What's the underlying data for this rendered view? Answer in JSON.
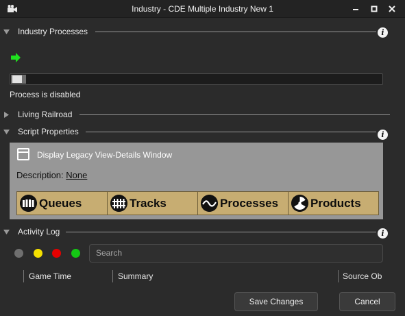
{
  "window": {
    "title": "Industry - CDE Multiple Industry New 1",
    "icon": "camera-icon",
    "controls": [
      "minimize-icon",
      "maximize-icon",
      "close-icon"
    ]
  },
  "sections": {
    "industry_processes": {
      "label": "Industry Processes",
      "expanded": true
    },
    "living_railroad": {
      "label": "Living Railroad",
      "expanded": false
    },
    "script_properties": {
      "label": "Script Properties",
      "expanded": true
    },
    "activity_log": {
      "label": "Activity Log",
      "expanded": true
    }
  },
  "process": {
    "status_text": "Process is disabled",
    "progress": 0.04,
    "arrow_color": "#1fe01f"
  },
  "script": {
    "legacy_label": "Display Legacy View-Details Window",
    "description_prefix": "Description:",
    "description_value": "None",
    "buttons": [
      {
        "label": "Queues",
        "icon": "queue-figures-icon"
      },
      {
        "label": "Tracks",
        "icon": "tracks-icon"
      },
      {
        "label": "Processes",
        "icon": "process-wave-icon"
      },
      {
        "label": "Products",
        "icon": "radiation-icon"
      }
    ],
    "panel_color": "#979797",
    "button_color": "#c7ad72"
  },
  "log": {
    "filters": [
      {
        "name": "grey",
        "color": "#6f6f6f"
      },
      {
        "name": "yellow",
        "color": "#f5e000"
      },
      {
        "name": "red",
        "color": "#e60000"
      },
      {
        "name": "green",
        "color": "#14c814"
      }
    ],
    "search_placeholder": "Search",
    "columns": [
      "Game Time",
      "Summary",
      "Source Ob"
    ]
  },
  "footer": {
    "save_label": "Save Changes",
    "cancel_label": "Cancel"
  },
  "info_glyph": "i"
}
